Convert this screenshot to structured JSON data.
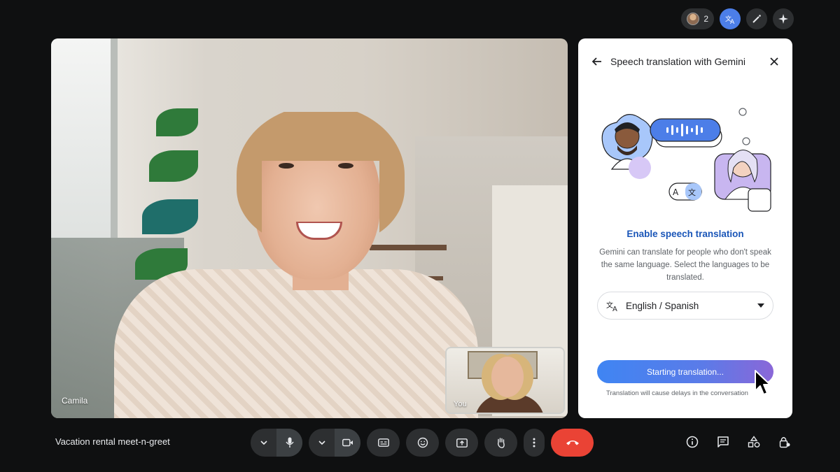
{
  "top_bar": {
    "participants_count": "2",
    "icons": [
      "participants-icon",
      "translate-icon",
      "magic-wand-icon",
      "sparkle-icon"
    ]
  },
  "stage": {
    "main_participant": "Camila",
    "self_label": "You"
  },
  "panel": {
    "title": "Speech translation with Gemini",
    "heading": "Enable speech translation",
    "description": "Gemini can translate for people who don't speak the same language. Select the languages to be translated.",
    "language_value": "English / Spanish",
    "start_button": "Starting translation...",
    "note": "Translation will cause delays in the conversation"
  },
  "bottom": {
    "meeting_title": "Vacation rental meet-n-greet"
  },
  "colors": {
    "accent": "#1a56b8",
    "end_call": "#ea4335",
    "button_gradient_start": "#3f85f3",
    "button_gradient_end": "#8a67d8"
  }
}
